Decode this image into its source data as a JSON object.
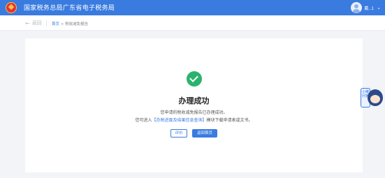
{
  "header": {
    "site_title": "国家税务总局广东省电子税务局",
    "user_name": "戴..1"
  },
  "breadcrumb": {
    "back_label": "返回",
    "home": "首页",
    "separator": ">",
    "current": "税收减免报告"
  },
  "result": {
    "title": "办理成功",
    "message": "您申请的税收减免报告已办理成功。",
    "hint_prefix": "您可进入",
    "hint_link": "【办税进度及结果信息查询】",
    "hint_suffix": "模块下载申请表或文书。",
    "evaluate_button": "评价",
    "home_button": "返回首页"
  },
  "helper": {
    "bubble_text": "小曦问答"
  },
  "colors": {
    "primary": "#3a7be0",
    "success": "#2bb36d"
  }
}
